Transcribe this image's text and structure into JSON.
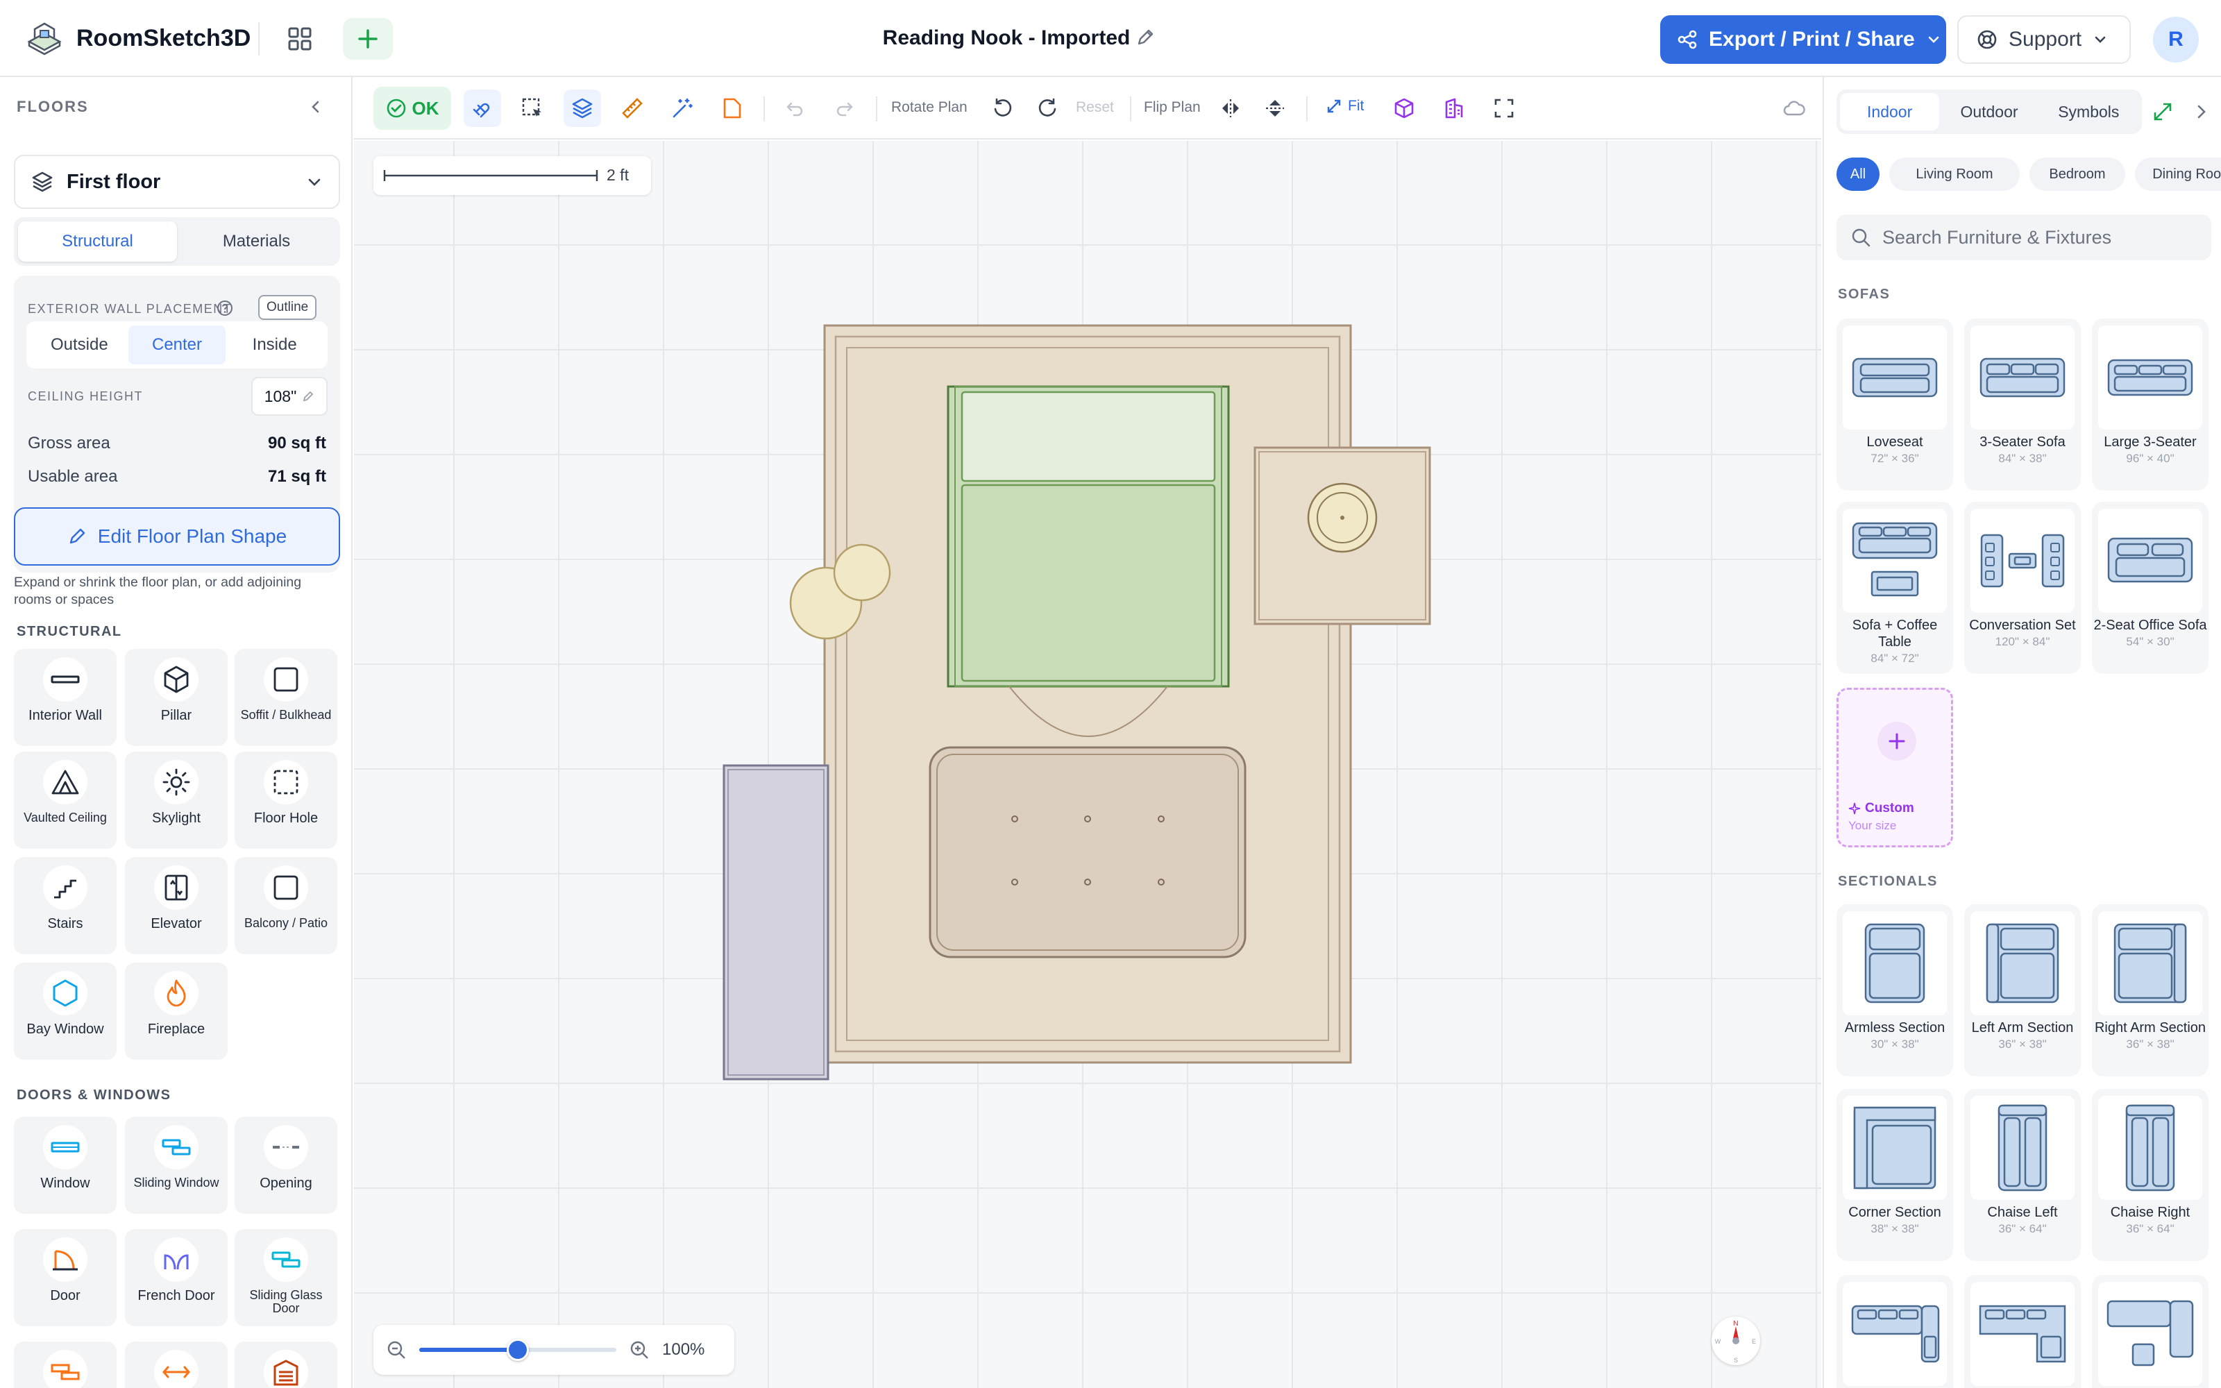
{
  "header": {
    "app_name": "RoomSketch3D",
    "doc_title": "Reading Nook - Imported",
    "export_label": "Export / Print / Share",
    "support_label": "Support",
    "avatar_initial": "R"
  },
  "left_panel": {
    "title": "FLOORS",
    "floor_select": "First floor",
    "tabs": [
      "Structural",
      "Materials"
    ],
    "wall_placement_label": "EXTERIOR WALL PLACEMENT",
    "outline_label": "Outline",
    "placement_options": [
      "Outside",
      "Center",
      "Inside"
    ],
    "ceiling_label": "CEILING HEIGHT",
    "ceiling_value": "108\"",
    "gross_label": "Gross area",
    "gross_value": "90 sq ft",
    "usable_label": "Usable area",
    "usable_value": "71 sq ft",
    "edit_shape_label": "Edit Floor Plan Shape",
    "hint": "Expand or shrink the floor plan, or add adjoining rooms or spaces",
    "structural_title": "STRUCTURAL",
    "structural_items": [
      {
        "label": "Interior Wall",
        "icon": "interior-wall-icon"
      },
      {
        "label": "Pillar",
        "icon": "pillar-icon"
      },
      {
        "label": "Soffit / Bulkhead",
        "icon": "soffit-icon"
      },
      {
        "label": "Vaulted Ceiling",
        "icon": "vaulted-ceiling-icon"
      },
      {
        "label": "Skylight",
        "icon": "skylight-icon"
      },
      {
        "label": "Floor Hole",
        "icon": "floor-hole-icon"
      },
      {
        "label": "Stairs",
        "icon": "stairs-icon"
      },
      {
        "label": "Elevator",
        "icon": "elevator-icon"
      },
      {
        "label": "Balcony / Patio",
        "icon": "balcony-icon"
      },
      {
        "label": "Bay Window",
        "icon": "bay-window-icon"
      },
      {
        "label": "Fireplace",
        "icon": "fireplace-icon"
      }
    ],
    "doors_title": "DOORS & WINDOWS",
    "door_items": [
      {
        "label": "Window",
        "icon": "window-icon"
      },
      {
        "label": "Sliding Window",
        "icon": "sliding-window-icon"
      },
      {
        "label": "Opening",
        "icon": "opening-icon"
      },
      {
        "label": "Door",
        "icon": "door-icon"
      },
      {
        "label": "French Door",
        "icon": "french-door-icon"
      },
      {
        "label": "Sliding Glass Door",
        "icon": "sliding-glass-door-icon"
      }
    ]
  },
  "toolbar": {
    "ok_label": "OK",
    "rotate_label": "Rotate Plan",
    "reset_label": "Reset",
    "flip_label": "Flip Plan",
    "fit_label": "Fit"
  },
  "canvas": {
    "scale_label": "2 ft",
    "zoom_value": "100%",
    "zoom_fraction": 0.5,
    "compass": {
      "n": "N",
      "w": "W",
      "e": "E",
      "s": "S"
    }
  },
  "right_panel": {
    "tabs": [
      "Indoor",
      "Outdoor",
      "Symbols"
    ],
    "chips": [
      "All",
      "Living Room",
      "Bedroom",
      "Dining Room"
    ],
    "search_placeholder": "Search Furniture & Fixtures",
    "sofas_title": "SOFAS",
    "sofas": [
      {
        "name": "Loveseat",
        "dims": "72\" × 36\""
      },
      {
        "name": "3-Seater Sofa",
        "dims": "84\" × 38\""
      },
      {
        "name": "Large 3-Seater",
        "dims": "96\" × 40\""
      },
      {
        "name": "Sofa + Coffee Table",
        "dims": "84\" × 72\""
      },
      {
        "name": "Conversation Set",
        "dims": "120\" × 84\""
      },
      {
        "name": "2-Seat Office Sofa",
        "dims": "54\" × 30\""
      }
    ],
    "custom_label": "Custom",
    "custom_sub": "Your size",
    "sectionals_title": "SECTIONALS",
    "sectionals": [
      {
        "name": "Armless Section",
        "dims": "30\" × 38\""
      },
      {
        "name": "Left Arm Section",
        "dims": "36\" × 38\""
      },
      {
        "name": "Right Arm Section",
        "dims": "36\" × 38\""
      },
      {
        "name": "Corner Section",
        "dims": "38\" × 38\""
      },
      {
        "name": "Chaise Left",
        "dims": "36\" × 64\""
      },
      {
        "name": "Chaise Right",
        "dims": "36\" × 64\""
      }
    ]
  },
  "colors": {
    "accent": "#2f6bde",
    "ok_green": "#16a34a",
    "custom_purple": "#9333ea",
    "rug": "#e8dccb",
    "bed_green": "#c9dcb8"
  }
}
